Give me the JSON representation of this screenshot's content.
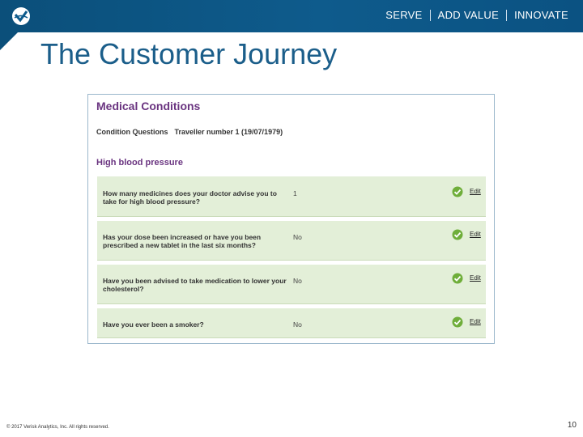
{
  "header": {
    "tagline": [
      "SERVE",
      "ADD VALUE",
      "INNOVATE"
    ],
    "colors": {
      "band": "#0e5b8c",
      "title": "#1b5e8a",
      "accent": "#6a3480",
      "row": "#e3efd8"
    }
  },
  "slide": {
    "title": "The Customer Journey"
  },
  "panel": {
    "title": "Medical Conditions",
    "condition_label": "Condition Questions",
    "traveller": "Traveller number 1 (19/07/1979)",
    "section": "High blood pressure",
    "questions": [
      {
        "question": "How many medicines does your doctor advise you to take for high blood pressure?",
        "answer": "1",
        "action": "Edit"
      },
      {
        "question": "Has your dose been increased or have you been prescribed a new tablet in the last six months?",
        "answer": "No",
        "action": "Edit"
      },
      {
        "question": "Have you been advised to take medication to lower your cholesterol?",
        "answer": "No",
        "action": "Edit"
      },
      {
        "question": "Have you ever been a smoker?",
        "answer": "No",
        "action": "Edit"
      }
    ]
  },
  "footer": {
    "copyright": "© 2017 Verisk Analytics, Inc. All rights reserved.",
    "page": "10"
  }
}
